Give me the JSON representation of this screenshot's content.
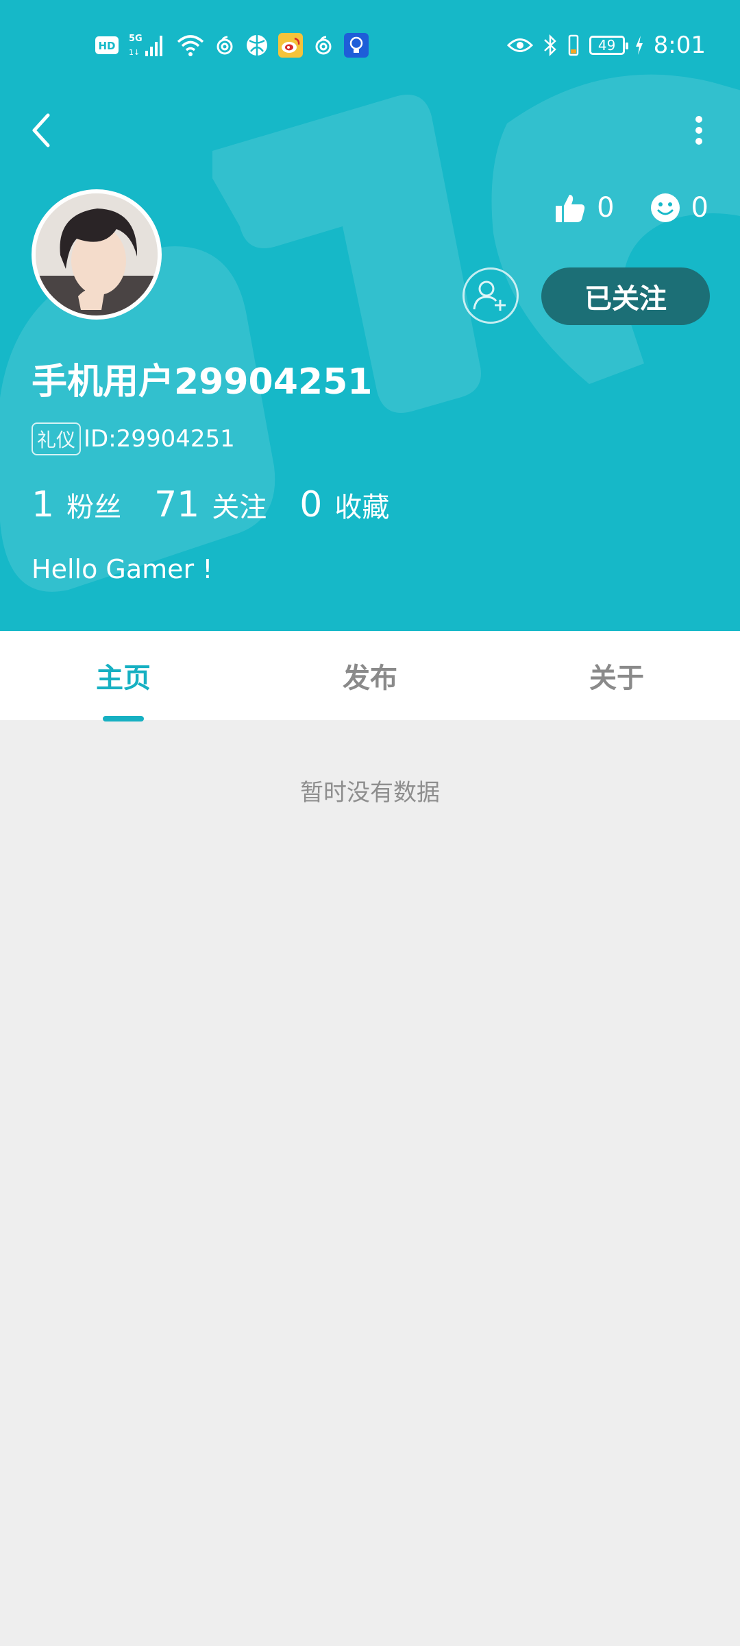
{
  "status_bar": {
    "network_label": "HD",
    "network_type": "5G",
    "battery_level": "49",
    "time": "8:01"
  },
  "profile": {
    "likes_count": "0",
    "reactions_count": "0",
    "follow_button_label": "已关注",
    "username": "手机用户29904251",
    "id_tag": "礼仪",
    "user_id": "ID:29904251",
    "followers_count": "1",
    "followers_label": "粉丝",
    "following_count": "71",
    "following_label": "关注",
    "favorites_count": "0",
    "favorites_label": "收藏",
    "bio": "Hello Gamer !"
  },
  "tabs": [
    {
      "label": "主页",
      "active": true
    },
    {
      "label": "发布",
      "active": false
    },
    {
      "label": "关于",
      "active": false
    }
  ],
  "content": {
    "empty_message": "暂时没有数据"
  },
  "colors": {
    "header_bg": "#16b8c8",
    "accent": "#16b0c2",
    "follow_button_bg": "#1c6f76",
    "page_bg": "#eeeeee"
  }
}
